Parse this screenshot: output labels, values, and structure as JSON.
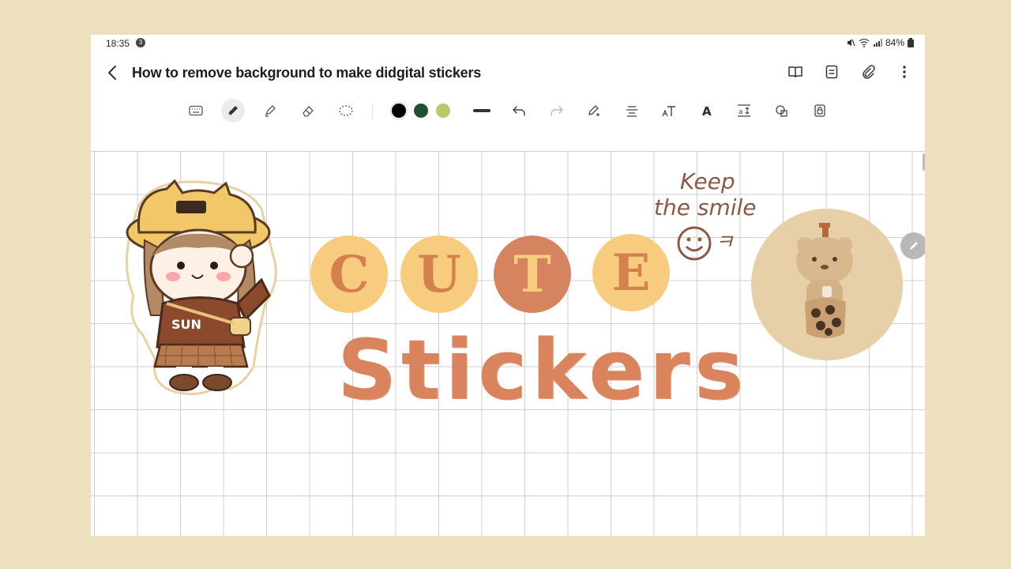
{
  "status": {
    "time": "18:35",
    "notification_count": "3",
    "battery": "84%"
  },
  "header": {
    "title": "How to remove background to make didgital stickers"
  },
  "colors": {
    "background": "#ece0bd",
    "accent_orange": "#d9845d",
    "letter_light_bg": "#f8cc7e",
    "letter_dark_bg": "#d6835f"
  },
  "toolbar": {
    "tools": [
      "keyboard-icon",
      "pen-icon",
      "highlighter-icon",
      "eraser-icon",
      "lasso-icon"
    ],
    "swatches": [
      "#000000",
      "#1f5131",
      "#bcc86b"
    ],
    "actions": [
      "stroke-width-icon",
      "undo-icon",
      "redo-icon",
      "pen-settings-icon",
      "text-align-icon",
      "text-icon",
      "text-style-icon",
      "text-size-icon",
      "shapes-icon",
      "lock-icon"
    ]
  },
  "canvas": {
    "cute_letters": [
      "C",
      "U",
      "T",
      "E"
    ],
    "stickers_text": "Stickers",
    "note_line1": "Keep",
    "note_line2": "the smile",
    "note_line3": "ㅋ"
  }
}
